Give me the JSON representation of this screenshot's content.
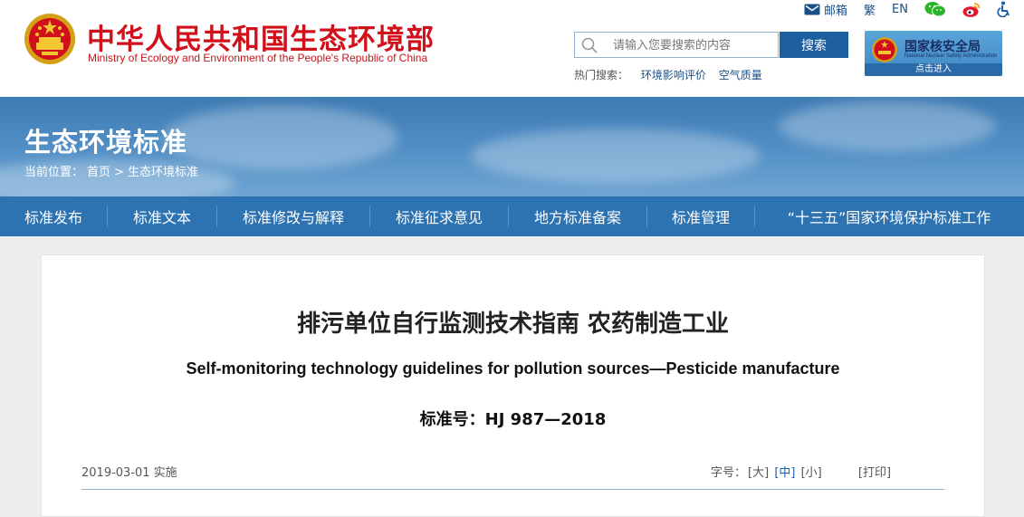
{
  "header": {
    "site_title_cn": "中华人民共和国生态环境部",
    "site_title_en": "Ministry of Ecology and Environment of the People's Republic of China",
    "top_links": {
      "mail": "邮箱",
      "traditional": "繁",
      "english": "EN"
    },
    "search": {
      "placeholder": "请输入您要搜索的内容",
      "button": "搜索"
    },
    "hot_search": {
      "label": "热门搜索：",
      "items": [
        "环境影响评价",
        "空气质量"
      ]
    },
    "nnsa_banner": {
      "cn": "国家核安全局",
      "en": "National Nuclear Safety Administration",
      "enter": "点击进入"
    }
  },
  "banner": {
    "title": "生态环境标准",
    "breadcrumb": {
      "label": "当前位置：",
      "home": "首页",
      "sep": ">",
      "current": "生态环境标准"
    }
  },
  "nav": {
    "items": [
      "标准发布",
      "标准文本",
      "标准修改与解释",
      "标准征求意见",
      "地方标准备案",
      "标准管理",
      "“十三五”国家环境保护标准工作"
    ]
  },
  "document": {
    "title_cn": "排污单位自行监测技术指南 农药制造工业",
    "title_en": "Self-monitoring technology guidelines for pollution sources—Pesticide manufacture",
    "standard_no": "标准号：HJ 987—2018",
    "date": "2019-03-01 实施",
    "font_size_label": "字号：",
    "font_large": "[大]",
    "font_medium": "[中]",
    "font_small": "[小]",
    "print": "[打印]"
  },
  "colors": {
    "brand_red": "#d0111b",
    "nav_blue": "#2d72b1",
    "search_blue": "#1d5e9f"
  }
}
